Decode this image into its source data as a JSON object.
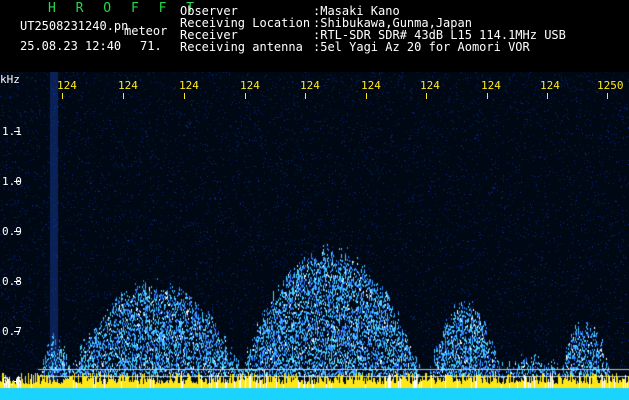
{
  "header": {
    "brand": "H R O F F T",
    "filename": "UT2508231240.pn",
    "mode": "meteor",
    "datetime": "25.08.23 12:40",
    "count": "71.",
    "fields": [
      {
        "label": "Observer",
        "value": ":Masaki Kano"
      },
      {
        "label": "Receiving Location",
        "value": ":Shibukawa,Gunma,Japan"
      },
      {
        "label": "Receiver",
        "value": ":RTL-SDR SDR# 43dB L15 114.1MHz USB"
      },
      {
        "label": "Receiving antenna",
        "value": ":5el Yagi Az 20 for Aomori VOR"
      }
    ]
  },
  "spectrogram": {
    "unit_label": "kHz",
    "y_ticks": [
      "1.1",
      "1.0",
      "0.9",
      "0.8",
      "0.7",
      "0.6"
    ],
    "x_ticks": [
      "124",
      "124",
      "124",
      "124",
      "124",
      "124",
      "124",
      "124",
      "124",
      "1250"
    ],
    "colors": {
      "background": "#000814",
      "noise": "#0a2a8a",
      "echo": "#49d2ff",
      "strong": "#ffffff",
      "base": "#ffe81a",
      "band": "#1ad3ff"
    }
  }
}
